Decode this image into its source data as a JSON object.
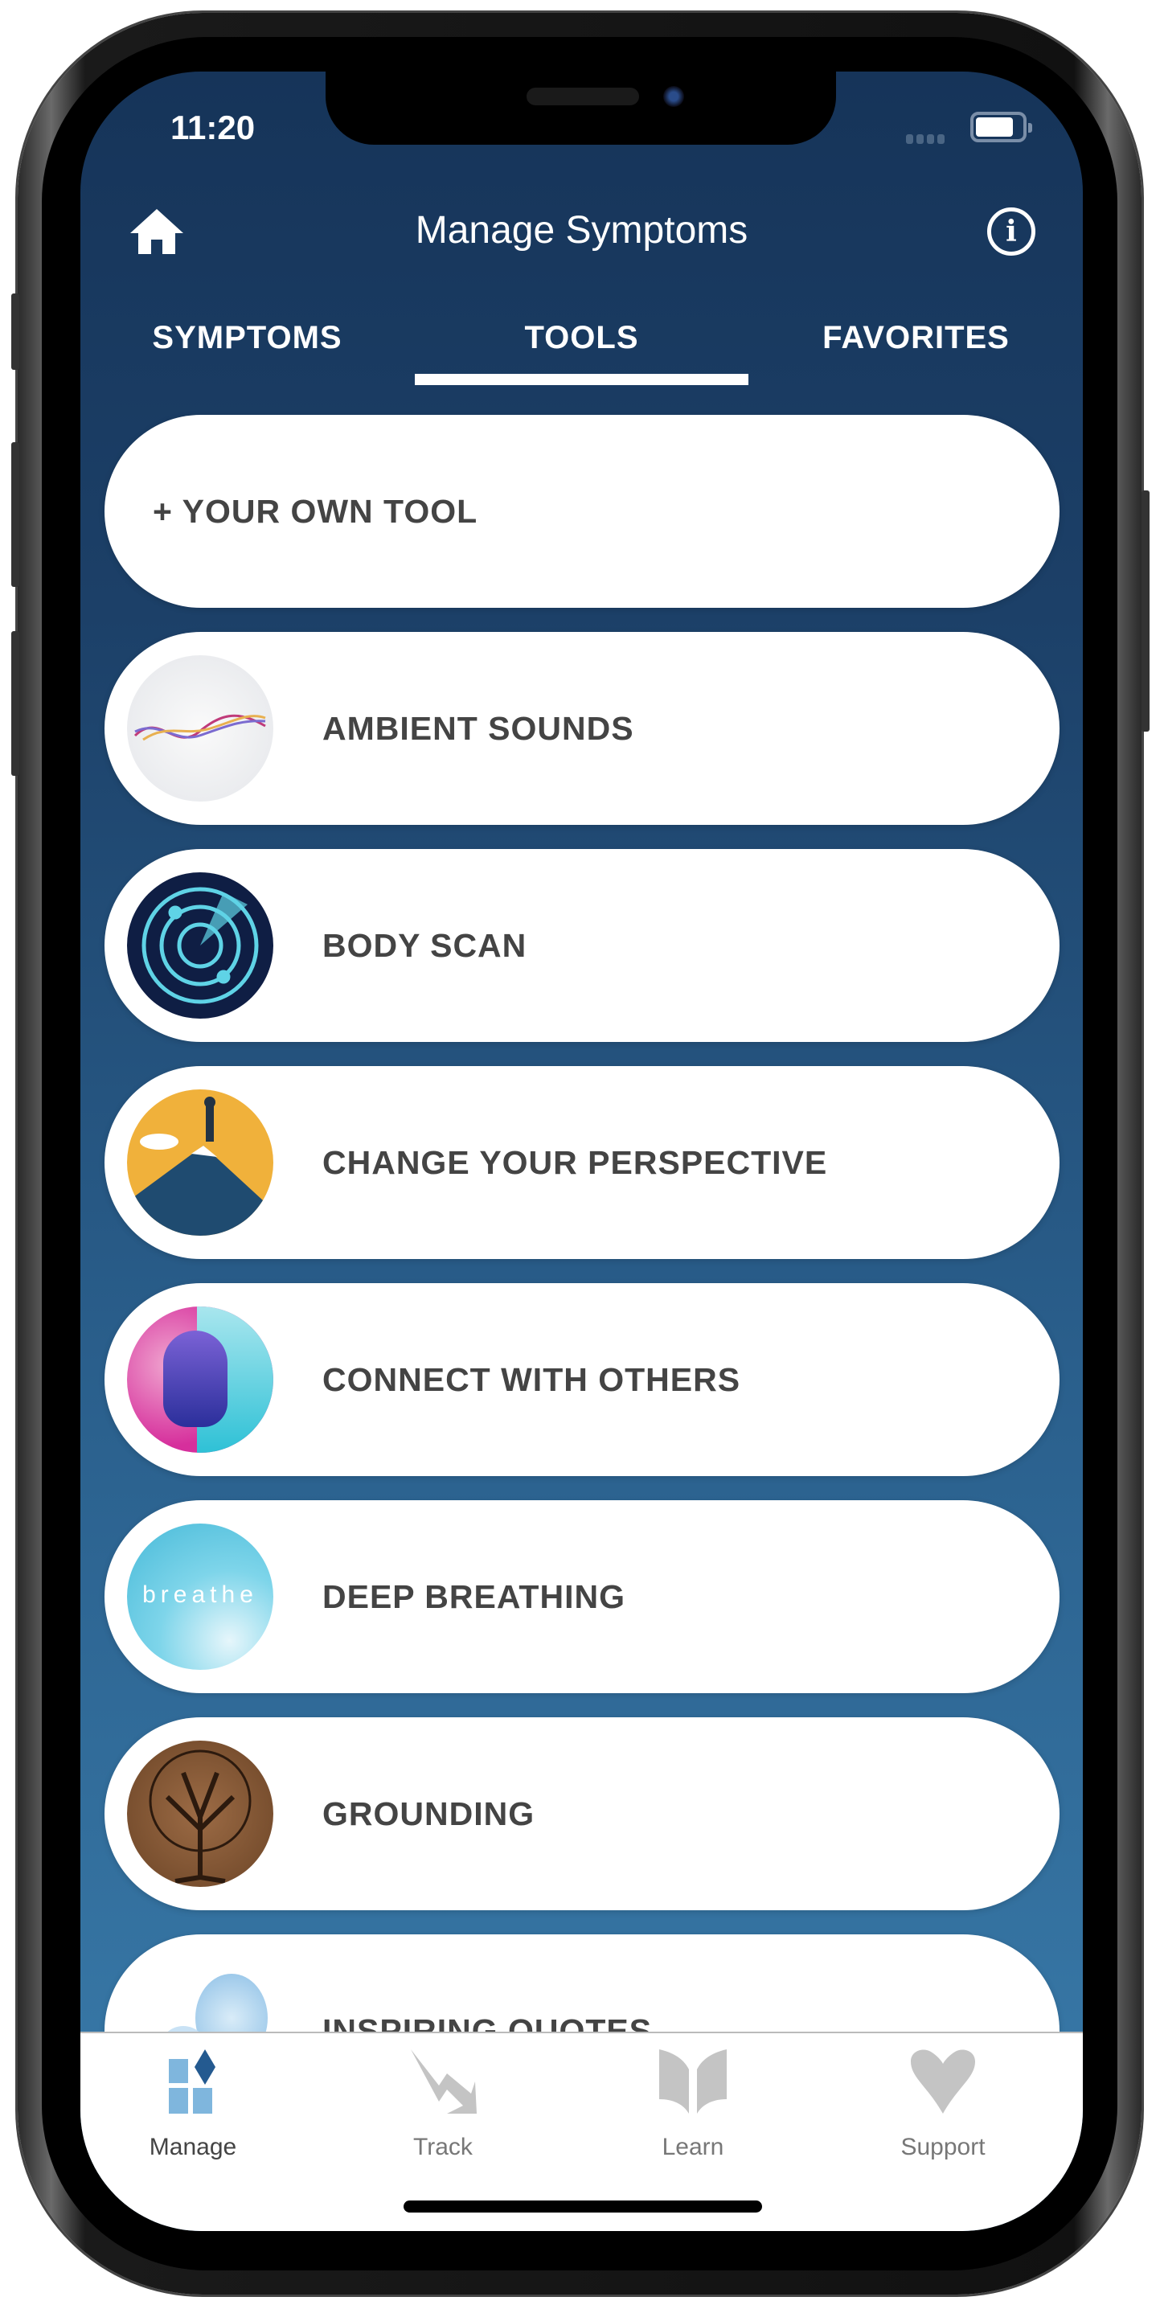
{
  "status_bar": {
    "time": "11:20"
  },
  "header": {
    "title": "Manage Symptoms",
    "home_icon": "home-icon",
    "info_icon": "info-icon"
  },
  "tabs": [
    {
      "label": "SYMPTOMS",
      "active": false
    },
    {
      "label": "TOOLS",
      "active": true
    },
    {
      "label": "FAVORITES",
      "active": false
    }
  ],
  "tools": [
    {
      "label": "+ YOUR OWN TOOL"
    },
    {
      "label": "AMBIENT SOUNDS",
      "image": "sound-wave-image"
    },
    {
      "label": "BODY SCAN",
      "image": "radar-image"
    },
    {
      "label": "CHANGE YOUR PERSPECTIVE",
      "image": "mountain-summit-image"
    },
    {
      "label": "CONNECT WITH OTHERS",
      "image": "faces-image"
    },
    {
      "label": "DEEP BREATHING",
      "image": "breathe-image",
      "image_text": "breathe"
    },
    {
      "label": "GROUNDING",
      "image": "tree-image"
    },
    {
      "label": "INSPIRING QUOTES",
      "image": "speech-bubbles-image"
    }
  ],
  "bottom_nav": [
    {
      "label": "Manage",
      "icon": "manage-icon",
      "active": true
    },
    {
      "label": "Track",
      "icon": "track-icon",
      "active": false
    },
    {
      "label": "Learn",
      "icon": "book-icon",
      "active": false
    },
    {
      "label": "Support",
      "icon": "heart-icon",
      "active": false
    }
  ],
  "colors": {
    "header_bg": "#163459",
    "gradient_bottom": "#3a7cab",
    "active_nav": "#7fb6dd",
    "active_nav_dark": "#245a90",
    "inactive_nav": "#c4c4c4",
    "card_text": "#444444"
  }
}
